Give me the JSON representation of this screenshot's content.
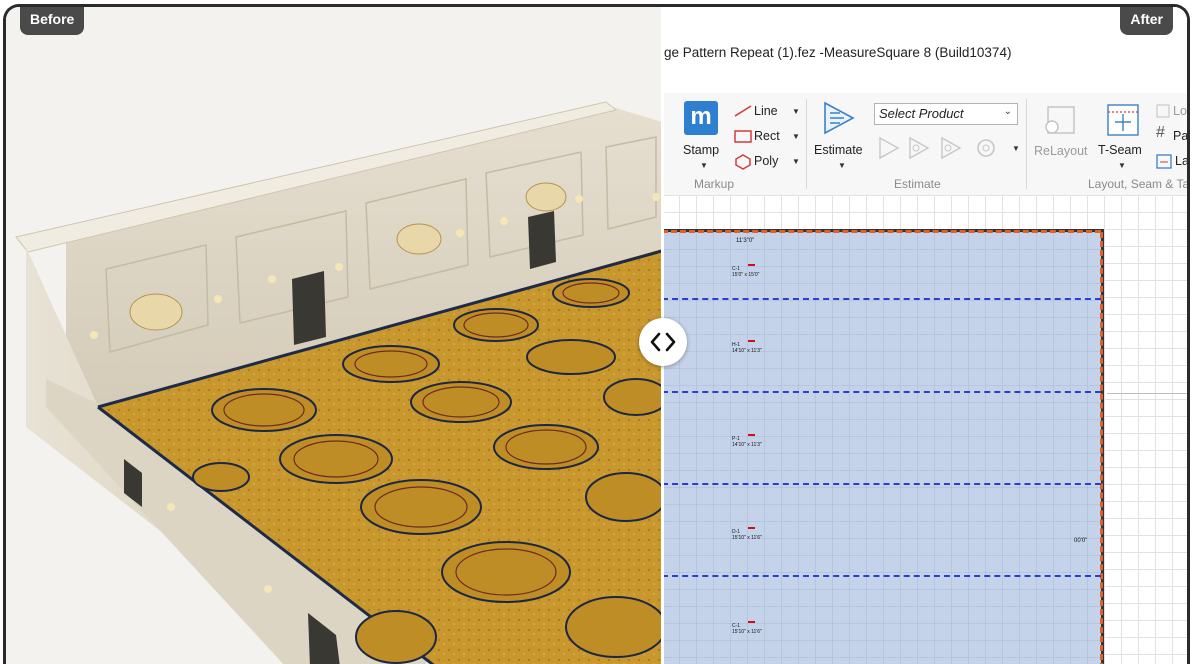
{
  "labels": {
    "before": "Before",
    "after": "After"
  },
  "slider": {
    "icon": "chevron-left-right-icon"
  },
  "window": {
    "title": "ge Pattern Repeat (1).fez -MeasureSquare 8 (Build10374)"
  },
  "ribbon": {
    "markup": {
      "label": "Markup",
      "stamp": "Stamp",
      "line": "Line",
      "rect": "Rect",
      "poly": "Poly"
    },
    "estimate": {
      "label": "Estimate",
      "estimate_button": "Estimate",
      "product_select": "Select Product"
    },
    "layout": {
      "label": "Layout, Seam & Ta",
      "relayout": "ReLayout",
      "tseam": "T-Seam",
      "loc": "Loc",
      "patt": "Patt",
      "lay": "Lay"
    }
  },
  "plan": {
    "dim_top": "11'3\"0\"",
    "dim_right": "00'0\"",
    "strips": [
      {
        "code": "C-1",
        "size": "15'0\" x 15'0\""
      },
      {
        "code": "H-1",
        "size": "14'10\" x 11'3\""
      },
      {
        "code": "P-1",
        "size": "14'10\" x 11'3\""
      },
      {
        "code": "D-1",
        "size": "15'10\" x 11'6\""
      },
      {
        "code": "C-1",
        "size": "15'10\" x 11'6\""
      }
    ]
  },
  "colors": {
    "room_fill": "#c4d3ea",
    "seam": "#2a3fd0",
    "edge": "#e0602a",
    "carpet": "#c8982e"
  }
}
